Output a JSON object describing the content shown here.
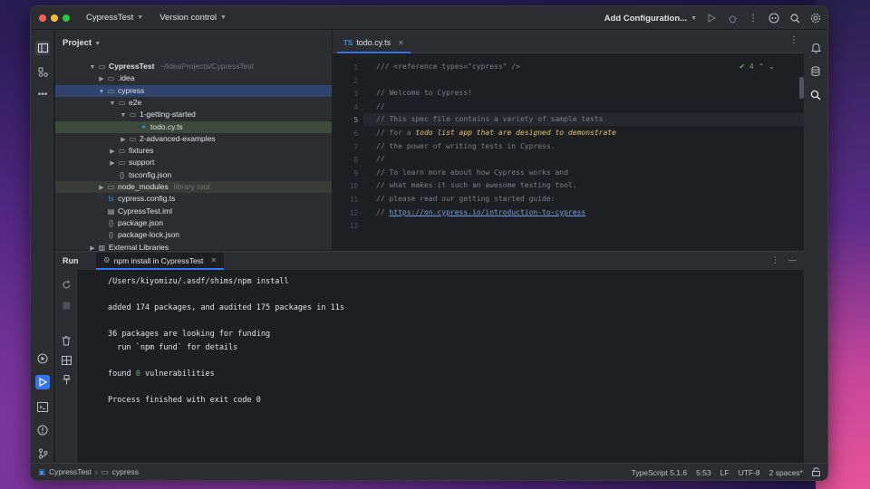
{
  "titlebar": {
    "project": "CypressTest",
    "vcs": "Version control",
    "run_config": "Add Configuration...",
    "icons": [
      "debug-icon",
      "copilot-icon",
      "search-icon",
      "settings-icon"
    ]
  },
  "project_panel": {
    "title": "Project",
    "tree": [
      {
        "label": "CypressTest",
        "hint": "~/IdeaProjects/CypressTest",
        "icon": "folder-icon",
        "depth": 0,
        "expanded": true
      },
      {
        "label": ".idea",
        "icon": "folder-icon",
        "depth": 1,
        "expanded": false
      },
      {
        "label": "cypress",
        "icon": "folder-icon",
        "depth": 1,
        "expanded": true,
        "selected": "blue"
      },
      {
        "label": "e2e",
        "icon": "folder-icon",
        "depth": 2,
        "expanded": true
      },
      {
        "label": "1-getting-started",
        "icon": "folder-icon",
        "depth": 3,
        "expanded": true
      },
      {
        "label": "todo.cy.ts",
        "icon": "ts-test-icon",
        "depth": 4,
        "selected": "green"
      },
      {
        "label": "2-advanced-examples",
        "icon": "folder-icon",
        "depth": 3,
        "expanded": false
      },
      {
        "label": "fixtures",
        "icon": "folder-icon",
        "depth": 2,
        "expanded": false
      },
      {
        "label": "support",
        "icon": "folder-icon",
        "depth": 2,
        "expanded": false
      },
      {
        "label": "tsconfig.json",
        "icon": "json-icon",
        "depth": 2
      },
      {
        "label": "node_modules",
        "hint": "library root",
        "icon": "folder-icon",
        "depth": 1,
        "expanded": false,
        "selected": "muted"
      },
      {
        "label": "cypress.config.ts",
        "icon": "ts-icon",
        "depth": 1
      },
      {
        "label": "CypressTest.iml",
        "icon": "iml-icon",
        "depth": 1
      },
      {
        "label": "package.json",
        "icon": "json-icon",
        "depth": 1
      },
      {
        "label": "package-lock.json",
        "icon": "json-icon",
        "depth": 1
      },
      {
        "label": "External Libraries",
        "icon": "library-icon",
        "depth": 0,
        "expanded": false
      }
    ]
  },
  "editor": {
    "tab": "todo.cy.ts",
    "inspection_count": "4",
    "lines": [
      {
        "n": "1",
        "text": "/// <reference types=\"cypress\" />"
      },
      {
        "n": "2",
        "text": ""
      },
      {
        "n": "3",
        "text": "// Welcome to Cypress!"
      },
      {
        "n": "4",
        "text": "//"
      },
      {
        "n": "5",
        "text": "// This spec file contains a variety of sample tests"
      },
      {
        "n": "6",
        "text": "// for a ",
        "kw": "todo list app that are designed to demonstrate"
      },
      {
        "n": "7",
        "text": "// the power of writing tests in Cypress."
      },
      {
        "n": "8",
        "text": "//"
      },
      {
        "n": "9",
        "text": "// To learn more about how Cypress works and"
      },
      {
        "n": "10",
        "text": "// what makes it such an awesome testing tool,"
      },
      {
        "n": "11",
        "text": "// please read our getting started guide:"
      },
      {
        "n": "12",
        "text": "// ",
        "link": "https://on.cypress.io/introduction-to-cypress"
      },
      {
        "n": "13",
        "text": ""
      }
    ],
    "current_line": "5"
  },
  "run": {
    "title": "Run",
    "tab": "npm install in CypressTest",
    "console": [
      "/Users/kiyomizu/.asdf/shims/npm install",
      "",
      "added 174 packages, and audited 175 packages in 11s",
      "",
      "36 packages are looking for funding",
      "  run `npm fund` for details",
      "",
      "found 0 vulnerabilities",
      "",
      "Process finished with exit code 0"
    ]
  },
  "statusbar": {
    "crumb_project": "CypressTest",
    "crumb_folder": "cypress",
    "language": "TypeScript 5.1.6",
    "position": "5:53",
    "line_sep": "LF",
    "encoding": "UTF-8",
    "indent": "2 spaces*"
  },
  "colors": {
    "accent": "#3574f0",
    "selection_blue": "#2e436e",
    "selection_green": "#3c4a3a",
    "keyword_italic": "#e0c46c",
    "link": "#6fa1e4",
    "success": "#6aab73"
  }
}
